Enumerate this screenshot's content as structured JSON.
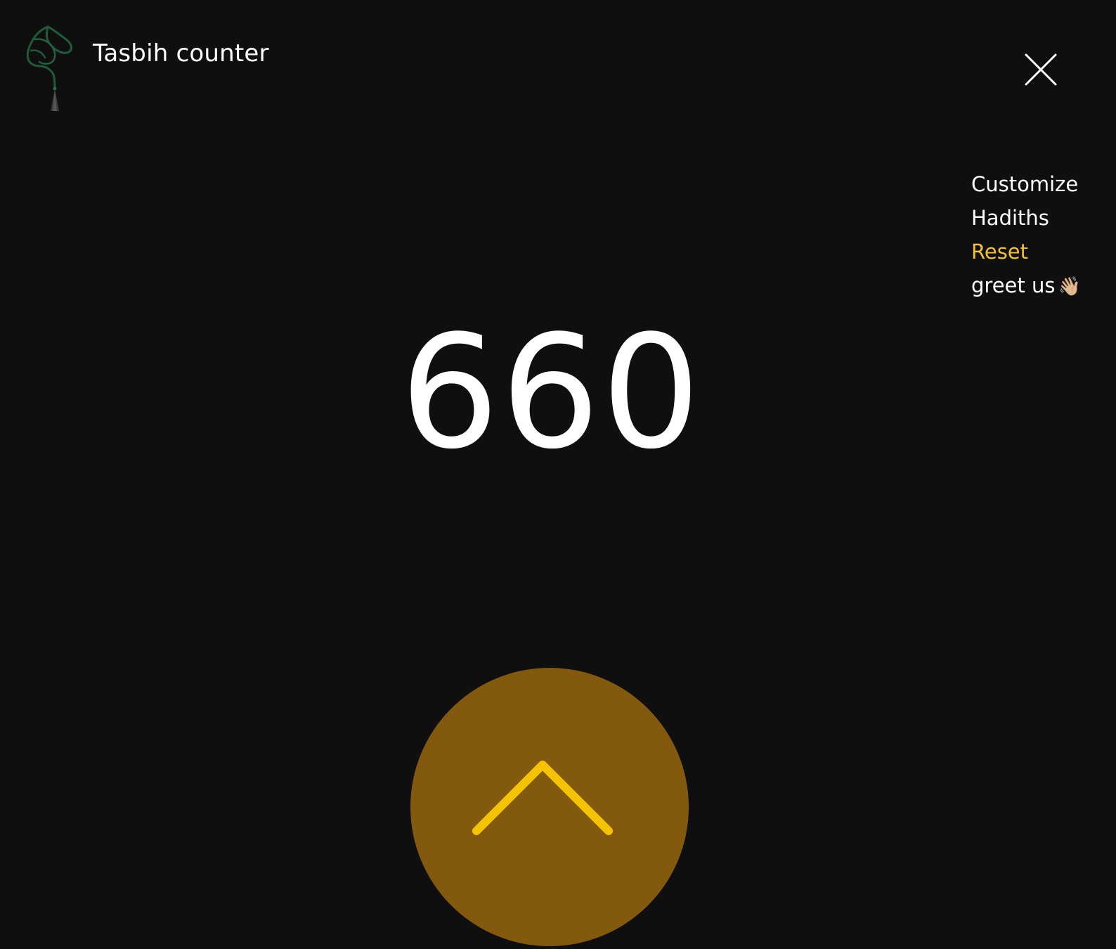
{
  "header": {
    "title": "Tasbih counter",
    "logo_icon": "tasbih-beads-icon",
    "close_icon": "close-icon"
  },
  "menu": {
    "items": [
      {
        "label": "Customize",
        "active": false
      },
      {
        "label": "Hadiths",
        "active": false
      },
      {
        "label": "Reset",
        "active": true
      },
      {
        "label": "greet us",
        "active": false,
        "emoji": "👋🏼"
      }
    ]
  },
  "counter": {
    "value": "660"
  },
  "count_button": {
    "icon": "chevron-up-icon"
  },
  "colors": {
    "background": "#0f0f10",
    "accent": "#f2c034",
    "button_fill": "#83590e",
    "chevron": "#f5c400",
    "logo_green": "#1f5a3a"
  }
}
